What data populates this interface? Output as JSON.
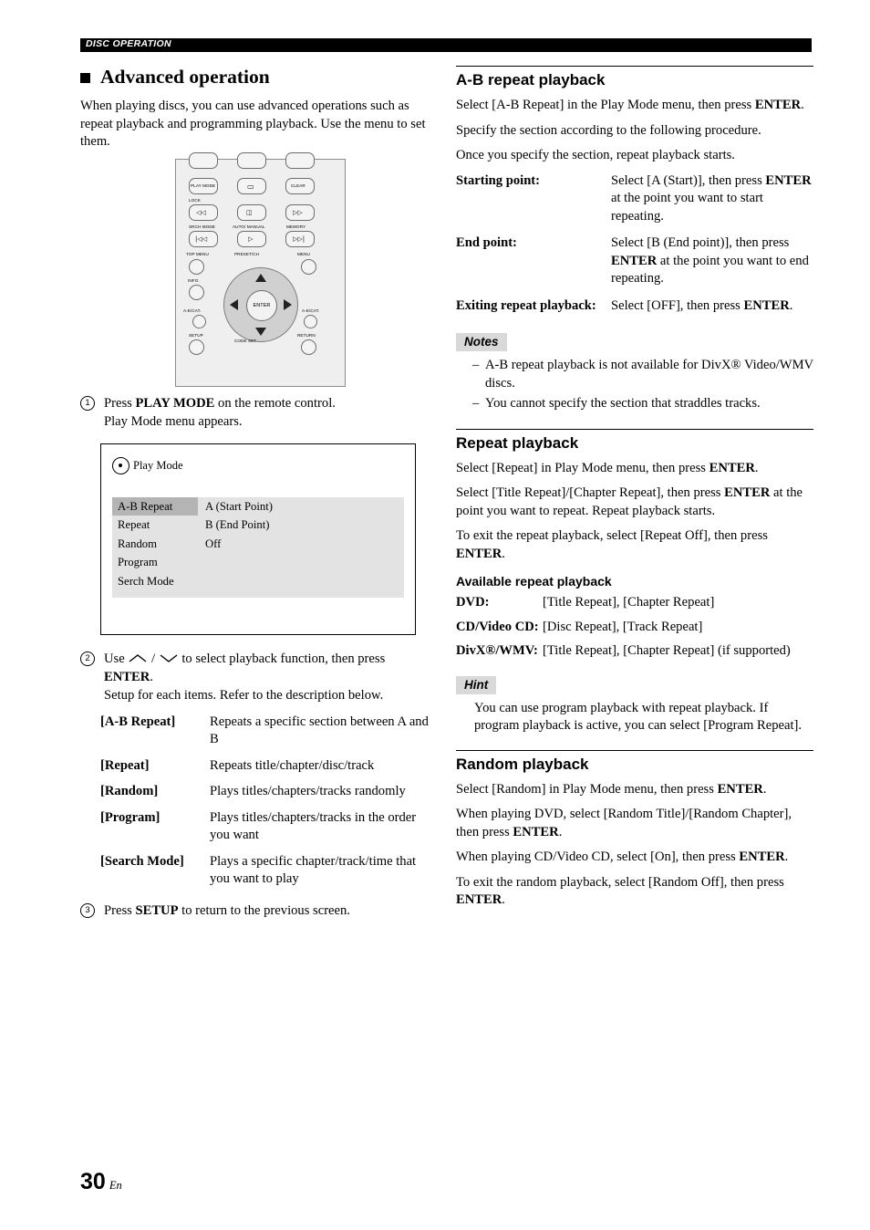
{
  "header": {
    "label": "DISC OPERATION"
  },
  "left": {
    "section_title": "Advanced operation",
    "intro": "When playing discs, you can use advanced operations such as repeat playback and programming playback. Use the menu to set them.",
    "remote": {
      "labels": {
        "play_mode": "PLAY MODE",
        "clear": "CLEAR",
        "lock": "LOCK",
        "srch_mode": "SRCH MODE",
        "auto_manual": "AUTO/ MANUAL",
        "memory": "MEMORY",
        "top_menu": "TOP MENU",
        "preset_ch": "PRESET/CH",
        "menu": "MENU",
        "info": "INFO.",
        "ae_cat_left": "A-E/CAT.",
        "ae_cat_right": "A-E/CAT.",
        "enter": "ENTER",
        "setup": "SETUP",
        "return": "RETURN",
        "code_set": "CODE SET"
      }
    },
    "step1_a": "Press ",
    "step1_b": "PLAY MODE",
    "step1_c": " on the remote control.",
    "step1_line2": "Play Mode menu appears.",
    "osd": {
      "title": "Play Mode",
      "left_items": [
        "A-B Repeat",
        "Repeat",
        "Random",
        "Program",
        "Serch Mode"
      ],
      "right_items": [
        "A (Start Point)",
        "B (End Point)",
        "Off"
      ],
      "selected_index": 0
    },
    "step2_a": "Use ",
    "step2_b": " / ",
    "step2_c": " to select playback function, then press ",
    "step2_enter": "ENTER",
    "step2_d": ".",
    "step2_line2": "Setup for each items. Refer to the description below.",
    "definitions": [
      {
        "term": "[A-B Repeat]",
        "desc": "Repeats a specific section between A and B"
      },
      {
        "term": "[Repeat]",
        "desc": "Repeats title/chapter/disc/track"
      },
      {
        "term": "[Random]",
        "desc": "Plays titles/chapters/tracks randomly"
      },
      {
        "term": "[Program]",
        "desc": "Plays titles/chapters/tracks in the order you want"
      },
      {
        "term": "[Search Mode]",
        "desc": "Plays a specific chapter/track/time that you want to play"
      }
    ],
    "step3_a": "Press ",
    "step3_b": "SETUP",
    "step3_c": " to return to the previous screen."
  },
  "right": {
    "ab_repeat": {
      "heading": "A-B repeat playback",
      "p1_a": "Select [A-B Repeat] in the Play Mode menu, then press ",
      "p1_b": "ENTER",
      "p1_c": ".",
      "p2": "Specify the section according to the following procedure.",
      "p3": "Once you specify the section, repeat playback starts.",
      "rows": [
        {
          "label": "Starting point:",
          "v1": "Select [A (Start)], then press ",
          "v2": "ENTER",
          "v3": " at the point you want to start repeating."
        },
        {
          "label": "End point:",
          "v1": "Select [B (End point)], then press ",
          "v2": "ENTER",
          "v3": " at the point you want to end repeating."
        },
        {
          "label": "Exiting repeat playback:",
          "v1": "Select [OFF], then press ",
          "v2": "ENTER",
          "v3": "."
        }
      ],
      "notes_tag": "Notes",
      "notes": [
        "A-B repeat playback is not available for DivX® Video/WMV discs.",
        "You cannot specify the section that straddles tracks."
      ]
    },
    "repeat": {
      "heading": "Repeat playback",
      "p1_a": "Select [Repeat] in Play Mode menu, then press ",
      "p1_b": "ENTER",
      "p1_c": ".",
      "p2_a": "Select [Title Repeat]/[Chapter Repeat], then press ",
      "p2_b": "ENTER",
      "p2_c": " at the point you want to repeat. Repeat playback starts.",
      "p3_a": "To exit the repeat playback, select [Repeat Off], then press ",
      "p3_b": "ENTER",
      "p3_c": ".",
      "sub_heading": "Available repeat playback",
      "table": [
        {
          "label": "DVD:",
          "value": "[Title Repeat], [Chapter Repeat]"
        },
        {
          "label": "CD/Video CD:",
          "value": "[Disc Repeat], [Track Repeat]"
        },
        {
          "label": "DivX®/WMV:",
          "value": "[Title Repeat], [Chapter Repeat] (if supported)"
        }
      ],
      "hint_tag": "Hint",
      "hint": "You can use program playback with repeat playback. If program playback is active, you can select [Program Repeat]."
    },
    "random": {
      "heading": "Random playback",
      "p1_a": "Select [Random] in Play Mode menu, then press ",
      "p1_b": "ENTER",
      "p1_c": ".",
      "p2_a": "When playing DVD, select [Random Title]/[Random Chapter], then press ",
      "p2_b": "ENTER",
      "p2_c": ".",
      "p3_a": "When playing CD/Video CD, select [On], then press ",
      "p3_b": "ENTER",
      "p3_c": ".",
      "p4_a": "To exit the random playback, select [Random Off], then press ",
      "p4_b": "ENTER",
      "p4_c": "."
    }
  },
  "footer": {
    "page": "30",
    "lang": "En"
  }
}
